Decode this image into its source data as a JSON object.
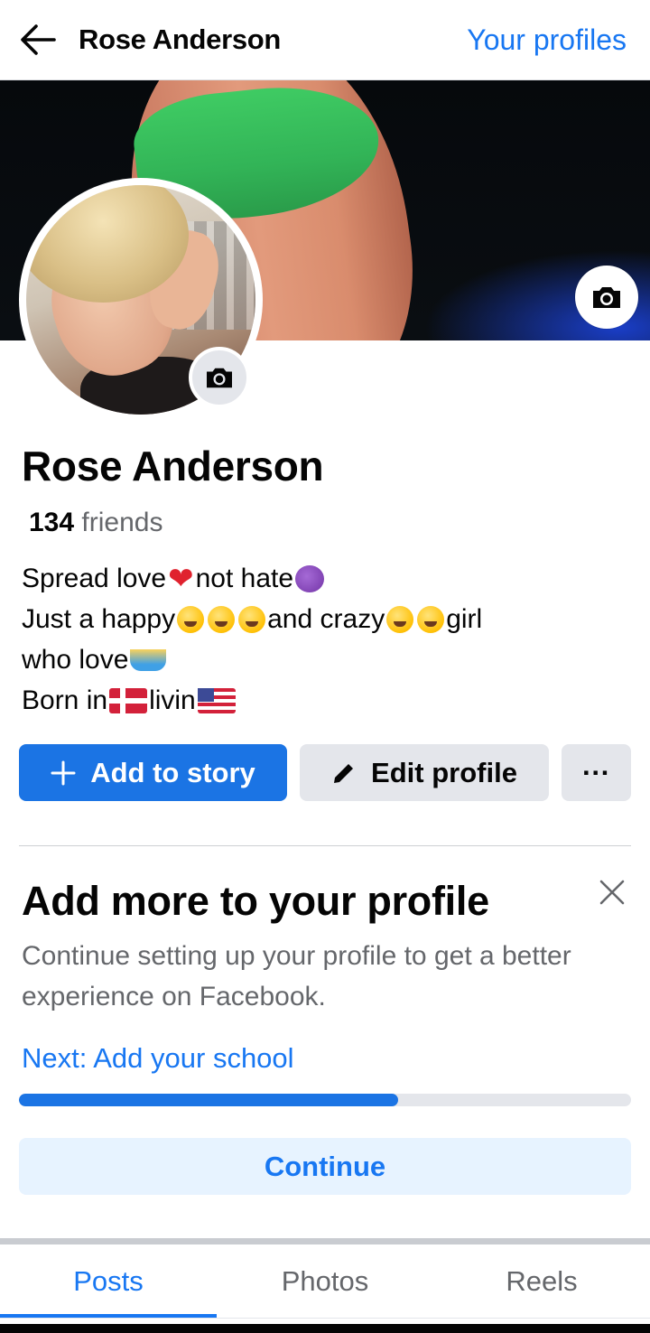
{
  "header": {
    "title": "Rose Anderson",
    "action_label": "Your profiles"
  },
  "profile": {
    "name": "Rose Anderson",
    "friends_count": "134",
    "friends_label": "friends",
    "bio": {
      "line1_a": "Spread love ",
      "line1_b": "not hate ",
      "line2_a": "Just a happy ",
      "line2_b": "and crazy",
      "line2_c": " girl",
      "line3_a": "who love ",
      "line4_a": "Born in ",
      "line4_b": " livin "
    }
  },
  "actions": {
    "add_story": "Add to story",
    "edit_profile": "Edit profile",
    "more": "···"
  },
  "setup_card": {
    "title": "Add more to your profile",
    "description": "Continue setting up your profile to get a better experience on Facebook.",
    "next_link": "Next: Add your school",
    "progress_percent": 62,
    "continue_label": "Continue"
  },
  "tabs": [
    {
      "label": "Posts",
      "active": true
    },
    {
      "label": "Photos",
      "active": false
    },
    {
      "label": "Reels",
      "active": false
    }
  ],
  "colors": {
    "accent": "#1877f2",
    "primary_button": "#1b74e4",
    "secondary_button": "#e4e6eb"
  }
}
